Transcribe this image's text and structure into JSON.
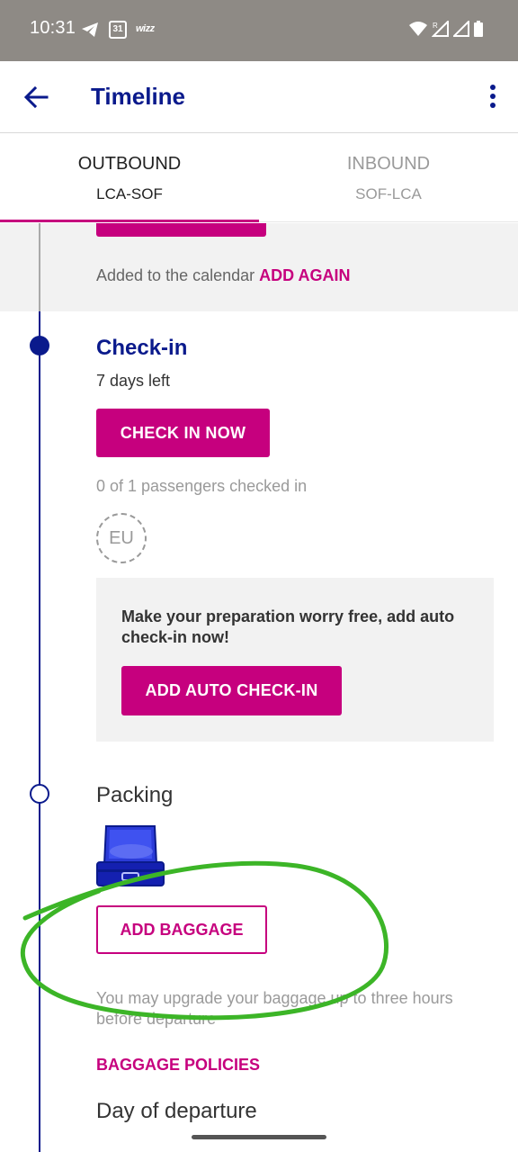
{
  "status_bar": {
    "time": "10:31",
    "calendar_day": "31",
    "app_badge": "wizz"
  },
  "header": {
    "title": "Timeline"
  },
  "tabs": [
    {
      "label": "OUTBOUND",
      "route": "LCA-SOF",
      "active": true
    },
    {
      "label": "INBOUND",
      "route": "SOF-LCA",
      "active": false
    }
  ],
  "calendar": {
    "text": "Added to the calendar",
    "link": "ADD AGAIN"
  },
  "checkin": {
    "title": "Check-in",
    "days_left": "7 days left",
    "button": "CHECK IN NOW",
    "passengers": "0 of 1 passengers checked in",
    "badge": "EU"
  },
  "auto_checkin": {
    "text": "Make your preparation worry free, add auto check-in now!",
    "button": "ADD AUTO CHECK-IN"
  },
  "packing": {
    "title": "Packing",
    "button": "ADD BAGGAGE",
    "note": "You may upgrade your baggage up to three hours before departure",
    "link": "BAGGAGE POLICIES"
  },
  "departure": {
    "title": "Day of departure"
  },
  "colors": {
    "brand_navy": "#0a1a8c",
    "brand_magenta": "#c6007e",
    "annotation_green": "#3cb527"
  }
}
